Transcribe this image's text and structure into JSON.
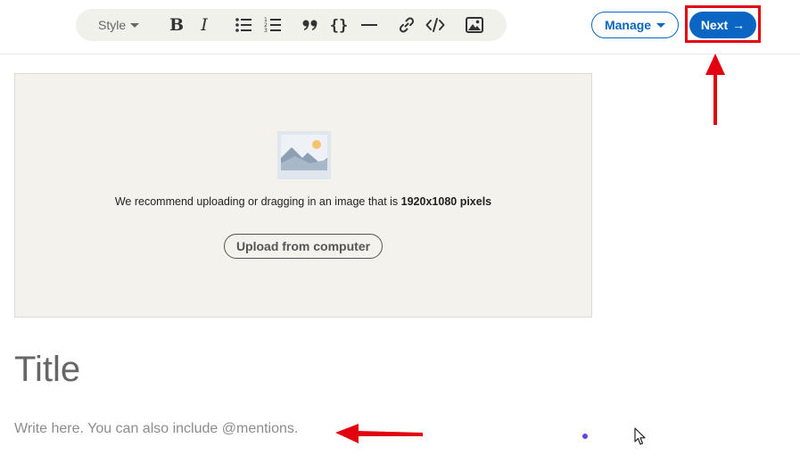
{
  "toolbar": {
    "style_label": "Style",
    "buttons": [
      {
        "name": "bold-icon",
        "glyph": "B"
      },
      {
        "name": "italic-icon",
        "glyph": "I"
      },
      {
        "name": "bulleted-list-icon"
      },
      {
        "name": "numbered-list-icon"
      },
      {
        "name": "quote-icon",
        "glyph": "❞"
      },
      {
        "name": "code-block-icon",
        "glyph": "{}"
      },
      {
        "name": "divider-icon",
        "glyph": "—"
      },
      {
        "name": "link-icon"
      },
      {
        "name": "embed-code-icon",
        "glyph": "</>"
      },
      {
        "name": "image-icon"
      }
    ]
  },
  "header": {
    "manage_label": "Manage",
    "next_label": "Next",
    "next_arrow": "→"
  },
  "upload": {
    "recommend_prefix": "We recommend uploading or dragging in an image that is ",
    "recommend_size": "1920x1080 pixels",
    "upload_button_label": "Upload from computer"
  },
  "editor": {
    "title_placeholder": "Title",
    "body_placeholder": "Write here. You can also include @mentions."
  },
  "colors": {
    "accent": "#0a66c2",
    "annotation_red": "#e3000f",
    "toolbar_bg": "#f1f1ec",
    "upload_bg": "#f3f2ec"
  }
}
